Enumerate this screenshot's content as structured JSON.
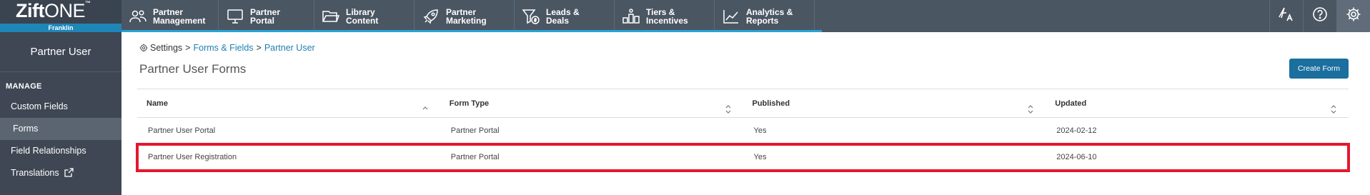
{
  "brand": {
    "logo_bold": "Zift",
    "logo_light": "ONE",
    "tm": "™",
    "tenant": "Franklin"
  },
  "nav": [
    {
      "label": "Partner\nManagement",
      "icon": "people-icon"
    },
    {
      "label": "Partner\nPortal",
      "icon": "monitor-icon"
    },
    {
      "label": "Library\nContent",
      "icon": "folder-icon"
    },
    {
      "label": "Partner\nMarketing",
      "icon": "rocket-icon"
    },
    {
      "label": "Leads &\nDeals",
      "icon": "funnel-dollar-icon"
    },
    {
      "label": "Tiers &\nIncentives",
      "icon": "tiers-icon"
    },
    {
      "label": "Analytics &\nReports",
      "icon": "line-chart-icon"
    }
  ],
  "right_icons": [
    "translate-icon",
    "help-icon",
    "settings-gear-icon"
  ],
  "sidebar": {
    "title": "Partner User",
    "section": "MANAGE",
    "items": [
      {
        "label": "Custom Fields"
      },
      {
        "label": "Forms"
      },
      {
        "label": "Field Relationships"
      },
      {
        "label": "Translations"
      }
    ]
  },
  "breadcrumb": {
    "settings": "Settings",
    "sep": ">",
    "forms_fields": "Forms & Fields",
    "partner_user": "Partner User"
  },
  "page_title": "Partner User Forms",
  "create_button": "Create Form",
  "table": {
    "headers": [
      "Name",
      "Form Type",
      "Published",
      "Updated"
    ],
    "rows": [
      [
        "Partner User Portal",
        "Partner Portal",
        "Yes",
        "2024-02-12"
      ],
      [
        "Partner User Registration",
        "Partner Portal",
        "Yes",
        "2024-06-10"
      ]
    ]
  },
  "colors": {
    "nav_bg": "#4b5663",
    "accent": "#29a3d6",
    "button": "#1b6f9e",
    "highlight": "#e3182d"
  }
}
